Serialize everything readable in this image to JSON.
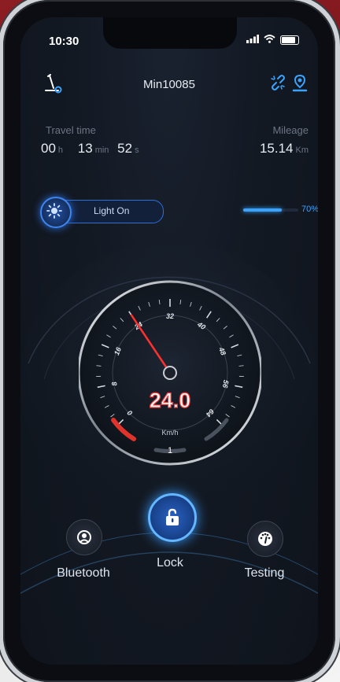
{
  "status_bar": {
    "time": "10:30",
    "signal": "▮▮▮"
  },
  "header": {
    "device_name": "Min10085"
  },
  "travel": {
    "label": "Travel time",
    "hours": "00",
    "hours_unit": "h",
    "minutes": "13",
    "minutes_unit": "min",
    "seconds": "52",
    "seconds_unit": "s"
  },
  "mileage": {
    "label": "Mileage",
    "value": "15.14",
    "unit": "Km"
  },
  "light": {
    "label": "Light On"
  },
  "battery": {
    "percent_label": "70%",
    "level": 0.7
  },
  "speedometer": {
    "speed": "24.0",
    "unit": "Km/h",
    "gear": "1",
    "ticks": [
      "0",
      "8",
      "16",
      "24",
      "32",
      "40",
      "48",
      "56",
      "64"
    ],
    "needle_value": 24
  },
  "controls": {
    "bluetooth": "Bluetooth",
    "lock": "Lock",
    "testing": "Testing"
  },
  "colors": {
    "accent": "#3aa3ff",
    "needle": "#ff3b3b",
    "background": "#131923"
  }
}
